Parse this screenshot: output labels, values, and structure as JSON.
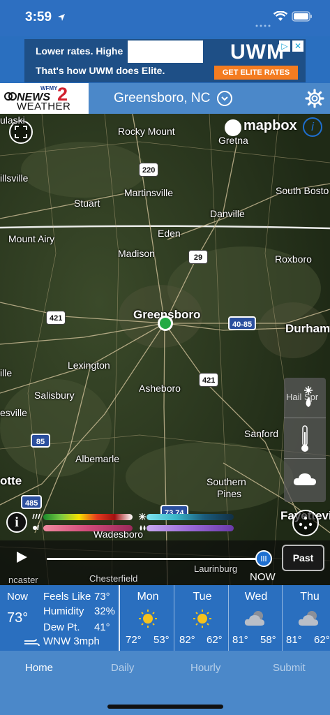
{
  "status_bar": {
    "time": "3:59",
    "location_icon": "location-arrow-icon",
    "signal_icon": "cellular-signal-icon",
    "wifi_icon": "wifi-icon",
    "battery_icon": "battery-icon"
  },
  "ad": {
    "line1": "Lower rates. Highe",
    "line2": "That's how UWM does Elite.",
    "logo": "UWM",
    "cta": "GET ELITE RATES",
    "adchoices_icon": "adchoices-icon",
    "close_icon": "close-icon"
  },
  "header": {
    "logo_small": "WFMY",
    "logo_news": "NEWS",
    "logo_2": "2",
    "logo_weather": "WEATHER",
    "location": "Greensboro, NC",
    "chevron_icon": "chevron-down-circle-icon",
    "settings_icon": "gear-icon"
  },
  "map": {
    "attribution": "mapbox",
    "cities": {
      "pulaski": "ulaski",
      "rocky_mount": "Rocky Mount",
      "gretna": "Gretna",
      "hillsville": "illsville",
      "martinsville": "Martinsville",
      "stuart": "Stuart",
      "south_boston": "South Bosto",
      "danville": "Danville",
      "eden": "Eden",
      "mount_airy": "Mount Airy",
      "madison": "Madison",
      "roxboro": "Roxboro",
      "greensboro": "Greensboro",
      "durham": "Durham",
      "lexington": "Lexington",
      "wilkesboro": "ille",
      "asheboro": "Asheboro",
      "salisbury": "Salisbury",
      "mooresville": "esville",
      "sanford": "Sanford",
      "albemarle": "Albemarle",
      "charlotte": "otte",
      "southern_pines": "Southern",
      "pines": "Pines",
      "fayetteville": "Fayettevi",
      "wadesboro": "Wadesboro",
      "chesterfield": "Chesterfield",
      "laurinburg": "Laurinburg",
      "lancaster": "ncaster"
    },
    "shields": {
      "us220": "220",
      "us29": "29",
      "us421_west": "421",
      "i40_85": "40-85",
      "us421_south": "421",
      "i85": "85",
      "i485": "485",
      "i73_74": "73 74"
    },
    "layers": {
      "hail_label": "Hail Spr",
      "temperature_icon": "thermometer-icon",
      "cloud_icon": "cloud-icon",
      "more_icon": "more-dots-icon"
    },
    "legend_info": "i",
    "player": {
      "past_label": "Past",
      "now_label": "NOW",
      "play_icon": "play-icon",
      "timeline_progress": 1.0
    }
  },
  "conditions": {
    "now_label": "Now",
    "now_temp": "73°",
    "feels_like_label": "Feels Like",
    "feels_like_value": "73°",
    "humidity_label": "Humidity",
    "humidity_value": "32%",
    "dew_label": "Dew Pt.",
    "dew_value": "41°",
    "wind_icon": "wind-icon",
    "wind_value": "WNW 3mph",
    "days": [
      {
        "name": "Mon",
        "icon": "sunny-icon",
        "high": "72°",
        "low": "53°"
      },
      {
        "name": "Tue",
        "icon": "sunny-icon",
        "high": "82°",
        "low": "62°"
      },
      {
        "name": "Wed",
        "icon": "partly-cloudy-icon",
        "high": "81°",
        "low": "58°"
      },
      {
        "name": "Thu",
        "icon": "partly-cloudy-icon",
        "high": "81°",
        "low": "62°"
      }
    ]
  },
  "tabs": [
    {
      "label": "Home"
    },
    {
      "label": "Daily"
    },
    {
      "label": "Hourly"
    },
    {
      "label": "Submit"
    }
  ],
  "colors": {
    "primary": "#2a6fbf",
    "header": "#4b88c9",
    "accent": "#1e6fd0",
    "marker": "#22aa44"
  }
}
